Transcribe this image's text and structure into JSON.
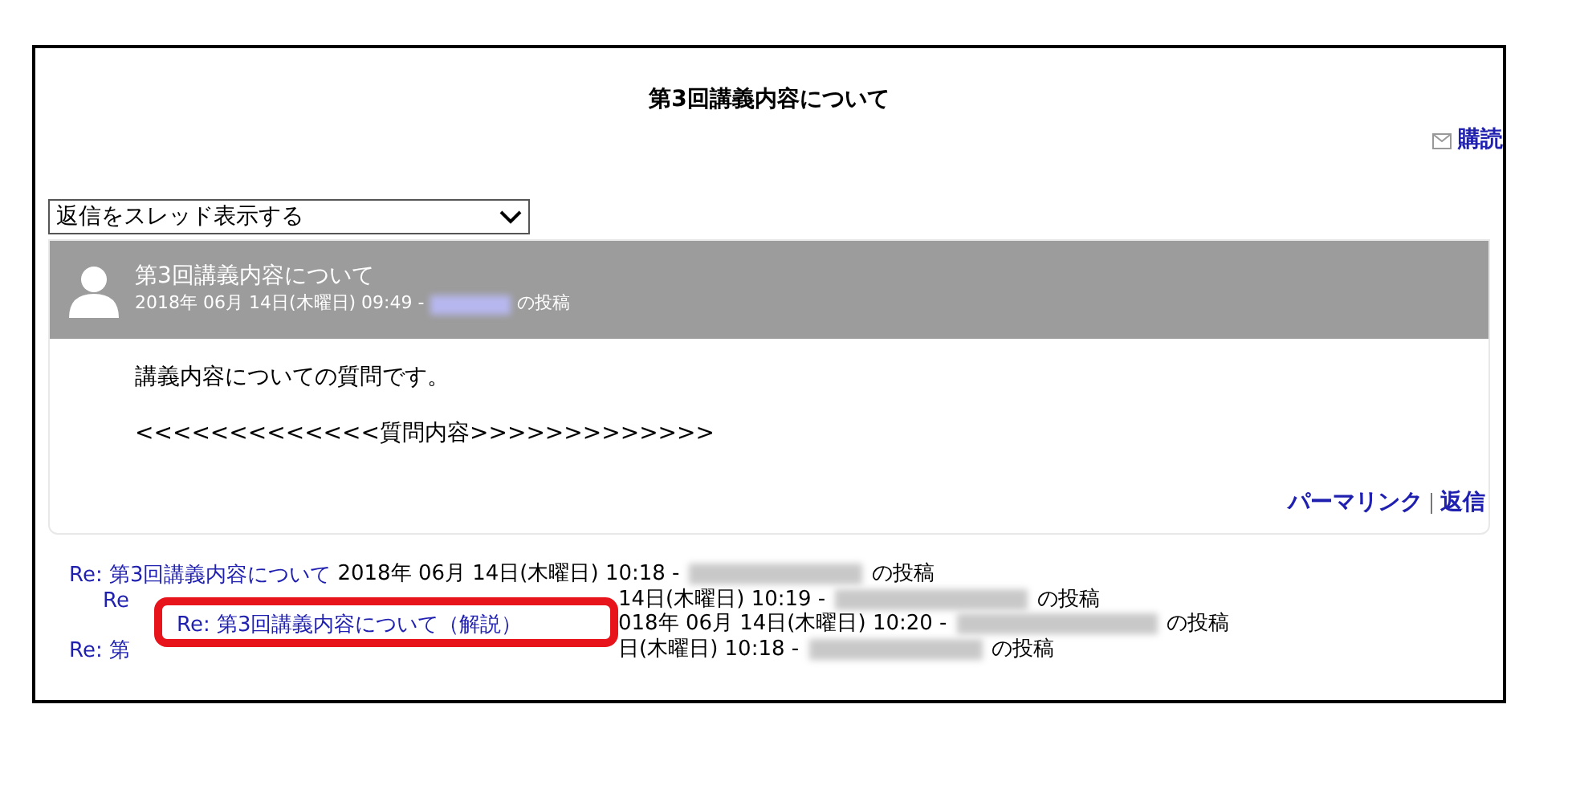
{
  "discussion": {
    "title": "第3回講義内容について",
    "subscribe": "購読"
  },
  "display_mode": {
    "value": "返信をスレッド表示する"
  },
  "post": {
    "title": "第3回講義内容について",
    "meta": "2018年 06月 14日(木曜日) 09:49 -",
    "meta_suffix": "の投稿",
    "body": [
      "講義内容についての質問です。",
      "<<<<<<<<<<<<<質問内容>>>>>>>>>>>>>"
    ],
    "links": [
      "パーマリンク",
      "返信"
    ]
  },
  "replies": [
    {
      "link": "Re: 第3回講義内容について",
      "meta": "2018年 06月 14日(木曜日) 10:18 -",
      "suffix": "の投稿",
      "cut": false,
      "children": [
        {
          "link": "Re",
          "meta": "14日(木曜日) 10:19 -",
          "suffix": "の投稿",
          "cut": true,
          "children": [
            {
              "link": "Re: 第3回講義内容について（解説）",
              "meta": "018年 06月 14日(木曜日) 10:20 -",
              "suffix": "の投稿",
              "cut": true,
              "highlighted": true
            }
          ]
        }
      ]
    },
    {
      "link": "Re: 第",
      "meta": "日(木曜日) 10:18 -",
      "suffix": "の投稿",
      "cut": true
    }
  ]
}
